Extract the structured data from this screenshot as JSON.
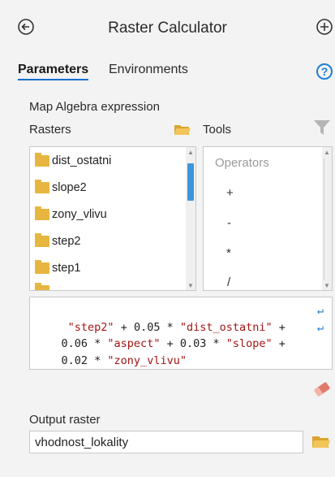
{
  "header": {
    "title": "Raster Calculator"
  },
  "tabs": [
    {
      "label": "Parameters",
      "active": true
    },
    {
      "label": "Environments",
      "active": false
    }
  ],
  "help_label": "?",
  "expression_label": "Map Algebra expression",
  "rasters": {
    "label": "Rasters",
    "items": [
      "dist_ostatni",
      "slope2",
      "zony_vlivu",
      "step2",
      "step1"
    ]
  },
  "tools": {
    "label": "Tools",
    "operators_label": "Operators",
    "operators": [
      "+",
      "-",
      "*",
      "/"
    ]
  },
  "expression": {
    "line1": [
      {
        "t": "\"step2\"",
        "c": "str"
      },
      {
        "t": " + 0.05 * ",
        "c": "num"
      },
      {
        "t": "\"dist_ostatni\"",
        "c": "str"
      },
      {
        "t": " + ",
        "c": "num"
      }
    ],
    "line2": [
      {
        "t": "0.06 * ",
        "c": "num"
      },
      {
        "t": "\"aspect\"",
        "c": "str"
      },
      {
        "t": " + 0.03 * ",
        "c": "num"
      },
      {
        "t": "\"slope\"",
        "c": "str"
      },
      {
        "t": " + ",
        "c": "num"
      }
    ],
    "line3": [
      {
        "t": "0.02 * ",
        "c": "num"
      },
      {
        "t": "\"zony_vlivu\"",
        "c": "str"
      }
    ]
  },
  "output": {
    "label": "Output raster",
    "value": "vhodnost_lokality"
  },
  "colors": {
    "accent": "#0b6fcf",
    "string": "#a31515",
    "folder": "#e7b640",
    "eraser": "#e07a6a"
  }
}
